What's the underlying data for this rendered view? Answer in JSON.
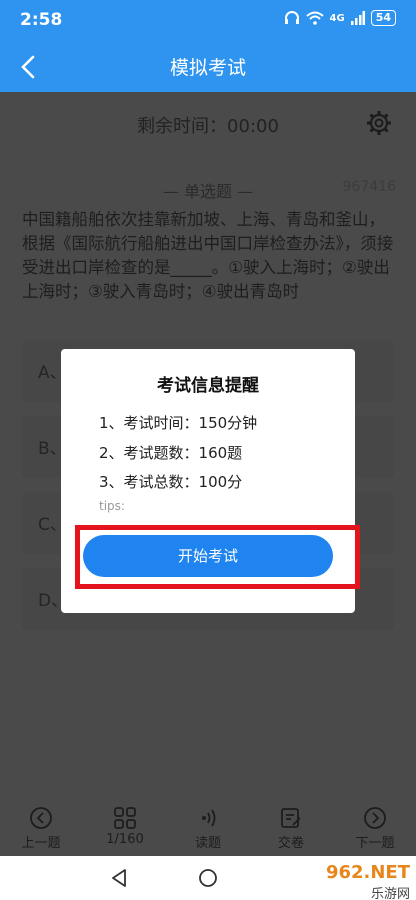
{
  "status_bar": {
    "time": "2:58",
    "signal": "4G",
    "battery": "54"
  },
  "header": {
    "title": "模拟考试"
  },
  "exam": {
    "timer": "剩余时间：00:00",
    "question_type": "— 单选题 —",
    "question_id": "967416",
    "question_text": "中国籍船舶依次挂靠新加坡、上海、青岛和釜山，根据《国际航行船舶进出中国口岸检查办法》，须接受进出口岸检查的是_____。①驶入上海时；②驶出上海时；③驶入青岛时；④驶出青岛时",
    "options": [
      {
        "label": "A、"
      },
      {
        "label": "B、"
      },
      {
        "label": "C、"
      },
      {
        "label": "D、①③"
      }
    ]
  },
  "modal": {
    "title": "考试信息提醒",
    "lines": [
      "1、考试时间：150分钟",
      "2、考试题数：160题",
      "3、考试总数：100分"
    ],
    "tips": "tips:",
    "start_button": "开始考试"
  },
  "toolbar": {
    "prev": "上一题",
    "count": "1/160",
    "read": "读题",
    "submit": "交卷",
    "next": "下一题"
  },
  "watermark": {
    "site": "962.NET",
    "name": "乐游网"
  },
  "colors": {
    "primary": "#2e94f0",
    "button": "#1f84f0",
    "highlight": "#e3141b",
    "overlay": "#4a4a4a"
  }
}
